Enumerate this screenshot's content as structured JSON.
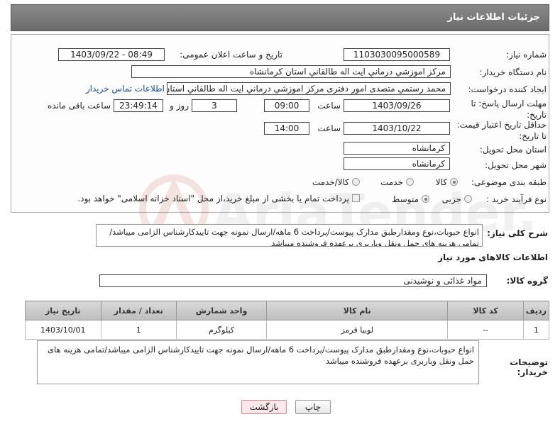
{
  "header": {
    "title": "جزئیات اطلاعات نیاز"
  },
  "fields": {
    "need_number_label": "شماره نیاز:",
    "need_number": "1103030095000589",
    "announce_label": "تاریخ و ساعت اعلان عمومی:",
    "announce_value": "1403/09/22 - 08:49",
    "buyer_label": "نام دستگاه خریدار:",
    "buyer_value": "مرکز اموزشي درماني ايت اله طالقاني استان کرمانشاه",
    "creator_label": "ایجاد کننده درخواست:",
    "creator_value": "محمد رستمي متصدی امور دفتری مرکز اموزشي درماني ايت اله طالقاني استان کرمانشاه",
    "contact_link": "اطلاعات تماس خریدار",
    "reply_label": "مهلت ارسال پاسخ: تا تاریخ:",
    "reply_date": "1403/09/26",
    "time_word": "ساعت",
    "reply_time": "09:00",
    "reply_days": "3",
    "days_word": "روز و",
    "remaining_time": "23:49:14",
    "remaining_word": "ساعت باقی مانده",
    "validity_label": "حداقل تاریخ اعتبار قیمت: تا تاریخ:",
    "validity_date": "1403/10/22",
    "validity_time": "14:00",
    "province_label": "استان محل تحویل:",
    "province_value": "کرمانشاه",
    "city_label": "شهر محل تحویل:",
    "city_value": "کرمانشاه",
    "category_label": "طبقه بندی موضوعی:",
    "category_options": [
      "کالا",
      "خدمت",
      "کالا/خدمت"
    ],
    "process_label": "نوع فرآیند خرید :",
    "process_options": [
      "جزیی",
      "متوسط"
    ],
    "payment_note": "پرداخت تمام یا بخشی از مبلغ خرید،از محل \"اسناد خزانه اسلامی\" خواهد بود."
  },
  "description": {
    "label": "شرح کلی نیاز:",
    "text": "انواع حبوبات،نوع ومقدارطبق مدارک پیوست/پرداخت 6 ماهه/ارسال نمونه جهت تاییدکارشناس الزامی میباشد/تمامی هزینه های حمل ونقل وباربری برعهده فروشنده میباشد"
  },
  "goods": {
    "section_title": "اطلاعات کالاهای مورد نیاز",
    "group_label": "گروه کالا:",
    "group_value": "مواد غذائی و نوشیدنی",
    "columns": [
      "ردیف",
      "کد کالا",
      "نام کالا",
      "واحد شمارش",
      "تعداد / مقدار",
      "تاریخ نیاز"
    ],
    "rows": [
      [
        "1",
        "--",
        "لوبیا قرمز",
        "کیلوگرم",
        "1",
        "1403/10/01"
      ]
    ]
  },
  "buyer_notes": {
    "label": "توضیحات خریدار:",
    "text": "انواع حبوبات،نوع ومقدارطبق مدارک پیوست/پرداخت 6 ماهه/ارسال نمونه جهت تاییدکارشناس الزامی میباشد/تمامی هزینه های حمل ونقل وباربری برعهده فروشنده میباشد"
  },
  "buttons": {
    "print": "چاپ",
    "back": "بازگشت"
  },
  "watermark": {
    "text": "AriaTender.net"
  },
  "colors": {
    "header_bg": "#7a7a7a",
    "link": "#1a4fa0",
    "back_button_bg": "#fde8ea"
  }
}
